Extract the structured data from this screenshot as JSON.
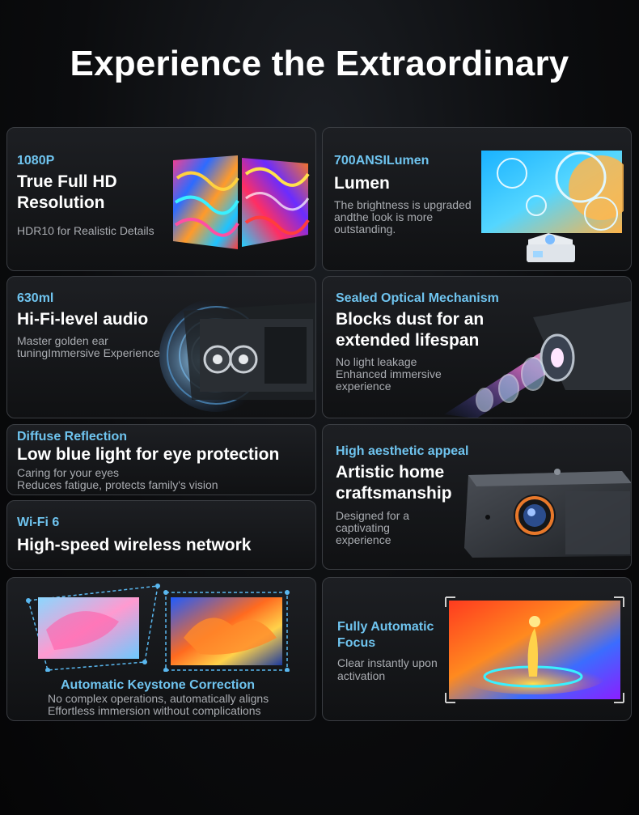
{
  "page": {
    "title": "Experience the Extraordinary"
  },
  "cards": {
    "resolution": {
      "tag": "1080P",
      "heading_line1": "True Full HD",
      "heading_line2": "Resolution",
      "desc": "HDR10 for Realistic Details"
    },
    "lumen": {
      "tag": "700ANSILumen",
      "heading": "Lumen",
      "desc_line1": "The brightness is upgraded",
      "desc_line2": "andthe look is more",
      "desc_line3": "outstanding."
    },
    "audio": {
      "tag": "630ml",
      "heading": "Hi-Fi-level audio",
      "desc_line1": "Master golden ear",
      "desc_line2": "tuningImmersive Experience"
    },
    "optical": {
      "tag": "Sealed Optical Mechanism",
      "heading_line1": "Blocks dust for an",
      "heading_line2": "extended lifespan",
      "desc_line1": "No light leakage",
      "desc_line2": "Enhanced immersive",
      "desc_line3": "experience"
    },
    "eye": {
      "tag": "Diffuse Reflection",
      "heading": "Low blue light for eye protection",
      "desc_line1": "Caring for your eyes",
      "desc_line2": "Reduces fatigue, protects family's vision"
    },
    "aesthetic": {
      "tag": "High aesthetic appeal",
      "heading_line1": "Artistic home",
      "heading_line2": "craftsmanship",
      "desc_line1": "Designed for a",
      "desc_line2": "captivating",
      "desc_line3": "experience"
    },
    "wifi": {
      "tag": "Wi-Fi 6",
      "heading": "High-speed wireless network"
    },
    "keystone": {
      "tag": "Automatic Keystone Correction",
      "desc_line1": "No complex operations, automatically aligns",
      "desc_line2": "Effortless immersion without complications"
    },
    "focus": {
      "tag_line1": "Fully Automatic",
      "tag_line2": "Focus",
      "desc_line1": "Clear instantly upon",
      "desc_line2": "activation"
    }
  },
  "colors": {
    "accent": "#6fc4ef",
    "card_border": "#3a3d42",
    "background": "#0b0c0e",
    "lens_ring": "#e8782a"
  }
}
